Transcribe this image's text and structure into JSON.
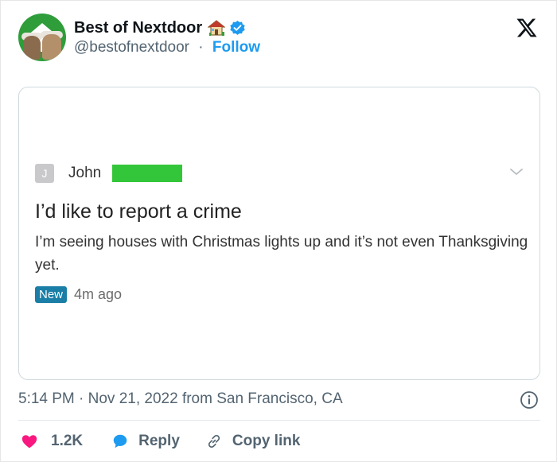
{
  "tweet": {
    "author": {
      "display_name": "Best of Nextdoor",
      "handle": "@bestofnextdoor",
      "separator": "·",
      "follow_label": "Follow",
      "avatar_icon": "muppets-avatar",
      "name_emoji_icon": "house-icon",
      "verified_icon": "verified-badge-icon"
    },
    "platform_icon": "x-logo-icon",
    "embedded_post": {
      "author_initial": "J",
      "author_name": "John",
      "title": "I’d like to report a crime",
      "body": "I’m seeing houses with Christmas lights up and it’s not even Thanksgiving yet.",
      "badge": "New",
      "time_ago": "4m ago"
    },
    "timestamp": "5:14 PM · Nov 21, 2022 from San Francisco, CA",
    "actions": {
      "likes": "1.2K",
      "reply_label": "Reply",
      "copy_label": "Copy link"
    }
  },
  "colors": {
    "accent": "#1d9bf0",
    "like": "#f91880",
    "badge": "#1a7ea6",
    "redaction": "#34c63a"
  }
}
